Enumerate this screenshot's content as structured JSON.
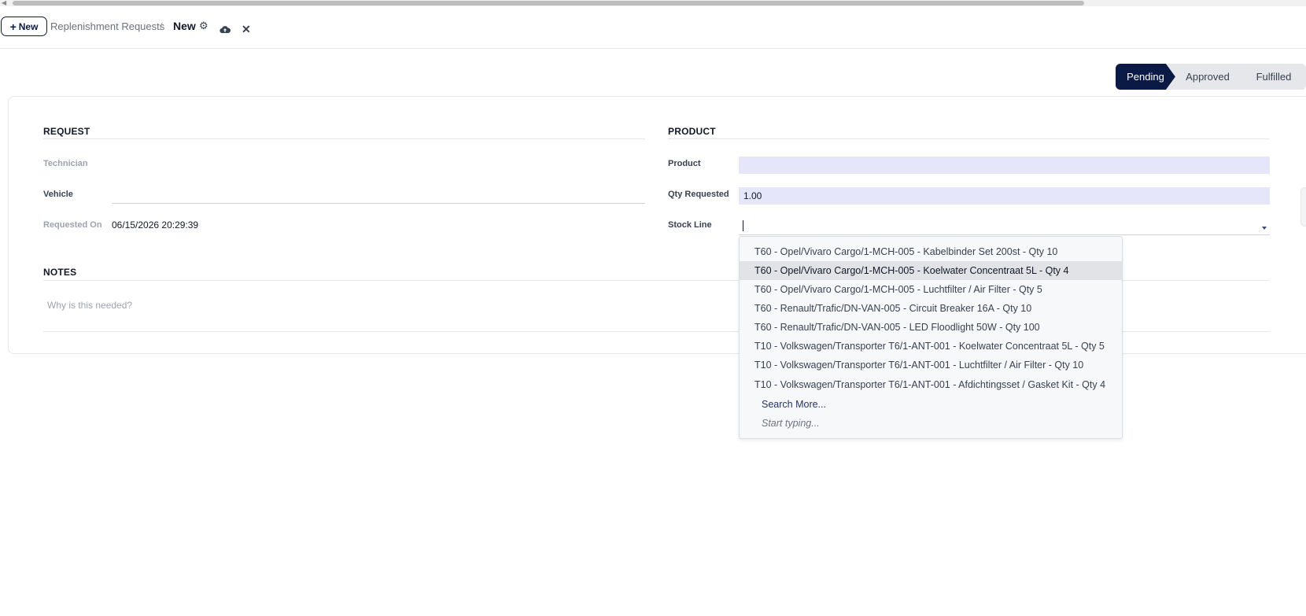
{
  "control_panel": {
    "new_button": "New",
    "breadcrumb_parent": "Replenishment Requests",
    "breadcrumb_separator": "/",
    "breadcrumb_current": "New"
  },
  "statusbar": {
    "stages": [
      "Pending",
      "Approved",
      "Fulfilled"
    ],
    "active": "Pending"
  },
  "form": {
    "request_group": {
      "title": "REQUEST",
      "technician_label": "Technician",
      "vehicle_label": "Vehicle",
      "requested_on_label": "Requested On",
      "requested_on_value": "06/15/2026 20:29:39"
    },
    "product_group": {
      "title": "PRODUCT",
      "product_label": "Product",
      "product_value": "",
      "qty_label": "Qty Requested",
      "qty_value": "1.00",
      "stock_line_label": "Stock Line"
    },
    "notes": {
      "title": "NOTES",
      "placeholder": "Why is this needed?"
    }
  },
  "dropdown": {
    "items": [
      "T60 - Opel/Vivaro Cargo/1-MCH-005 - Kabelbinder Set 200st - Qty 10",
      "T60 - Opel/Vivaro Cargo/1-MCH-005 - Koelwater Concentraat 5L - Qty 4",
      "T60 - Opel/Vivaro Cargo/1-MCH-005 - Luchtfilter / Air Filter - Qty 5",
      "T60 - Renault/Trafic/DN-VAN-005 - Circuit Breaker 16A - Qty 10",
      "T60 - Renault/Trafic/DN-VAN-005 - LED Floodlight 50W - Qty 100",
      "T10 - Volkswagen/Transporter T6/1-ANT-001 - Koelwater Concentraat 5L - Qty 5",
      "T10 - Volkswagen/Transporter T6/1-ANT-001 - Luchtfilter / Air Filter - Qty 10",
      "T10 - Volkswagen/Transporter T6/1-ANT-001 - Afdichtingsset / Gasket Kit - Qty 4"
    ],
    "highlighted_index": 1,
    "search_more": "Search More...",
    "start_typing": "Start typing..."
  },
  "colors": {
    "brand": "#0b1a44",
    "input_fill": "#e6e6fa",
    "stage_inactive": "#e5e7eb"
  }
}
